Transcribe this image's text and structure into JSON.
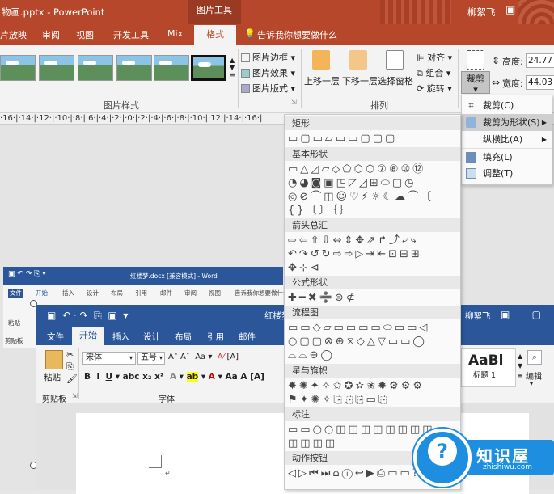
{
  "pp": {
    "title": "物画.pptx - PowerPoint",
    "context_tab": "图片工具",
    "user": "柳絮飞",
    "tabs": [
      "片放映",
      "审阅",
      "视图",
      "开发工具",
      "Mix",
      "格式"
    ],
    "tell_me": "告诉我你想要做什么",
    "picture_border": "图片边框",
    "picture_effects": "图片效果",
    "picture_layout": "图片版式",
    "picture_styles_group": "图片样式",
    "align": "对齐",
    "group": "组合",
    "rotate": "旋转",
    "bring_forward": "上移一层",
    "send_backward": "下移一层",
    "selection_pane": "选择窗格",
    "arrange_group": "排列",
    "crop": "裁剪",
    "height_label": "高度:",
    "height_value": "24.77",
    "width_label": "宽度:",
    "width_value": "44.03",
    "ruler": "·16·|·14·|·12·|·10·|·8·|·6·|·4·|·2·|·0·|·2·|·4·|·6·|·8·|·10·|·12·|·14·|·16·|"
  },
  "crop_menu": [
    {
      "label": "裁剪(C)",
      "icon": "crop-icon"
    },
    {
      "label": "裁剪为形状(S)",
      "icon": "shape-icon",
      "submenu": true
    },
    {
      "label": "纵横比(A)",
      "icon": "",
      "submenu": true
    },
    {
      "label": "填充(L)",
      "icon": "fill-icon"
    },
    {
      "label": "调整(T)",
      "icon": "fit-icon"
    }
  ],
  "shape_menu": [
    {
      "category": "矩形",
      "rows": [
        "▭▢▭▱▭▭▢▢▢"
      ]
    },
    {
      "category": "基本形状",
      "rows": [
        "▭△◿▱◇⬠⬡⬡⑦⑧⑩⑫",
        "◔◕◙▣◳◸◿⊞⬭▢◷",
        "◎⊘⌒◫☺♡⚡☼☾☁⌒〔",
        "{}〔〕｛｝"
      ]
    },
    {
      "category": "箭头总汇",
      "rows": [
        "⇨⇦⇧⇩⇔⇕✥⇗↱⤴⤶⤷",
        "↶↷↺↻⇨⇨▷⇥⇤⊡⊟⊞",
        "✥⊹⊲"
      ]
    },
    {
      "category": "公式形状",
      "rows": [
        "✚━✖➗⊜⊄"
      ]
    },
    {
      "category": "流程图",
      "rows": [
        "▭▭◇▱▭▭▭▭⬭▭▭◁",
        "○▢▢⊗⊕⧖◇△▽▭▭◯",
        "⌓⌓⊖◯"
      ]
    },
    {
      "category": "星与旗帜",
      "rows": [
        "✸✺✦✧✩✪✫✬✹⚙⚙⚙",
        "⚑✦✺✧⎘⎘⎘▭⎘"
      ]
    },
    {
      "category": "标注",
      "rows": [
        "▭▭○○◫◫◫◫◫◫◫◫",
        "◫◫◫◫"
      ]
    },
    {
      "category": "动作按钮",
      "rows": [
        "◁▷⏮⏭⌂ⓘ↩▶⎙▭▭?"
      ]
    }
  ],
  "word_back": {
    "title": "红楼梦.docx [兼容模式] - Word",
    "tabs": [
      "文件",
      "开始",
      "插入",
      "设计",
      "布局",
      "引用",
      "邮件",
      "审阅",
      "视图",
      "告诉我你想要做什么"
    ],
    "paste": "粘贴",
    "clipboard": "剪贴板"
  },
  "word": {
    "title": "红楼梦",
    "user": "柳絮飞",
    "tabs": [
      "文件",
      "开始",
      "插入",
      "设计",
      "布局",
      "引用",
      "邮件"
    ],
    "paste": "粘贴",
    "clipboard": "剪贴板",
    "font_name": "宋体",
    "font_size": "五号",
    "font_group": "字体",
    "style_preview": "AaBl",
    "style_name": "标题 1",
    "edit": "编辑"
  },
  "watermark": {
    "title": "知识屋",
    "sub": "zhishiwu.com"
  }
}
